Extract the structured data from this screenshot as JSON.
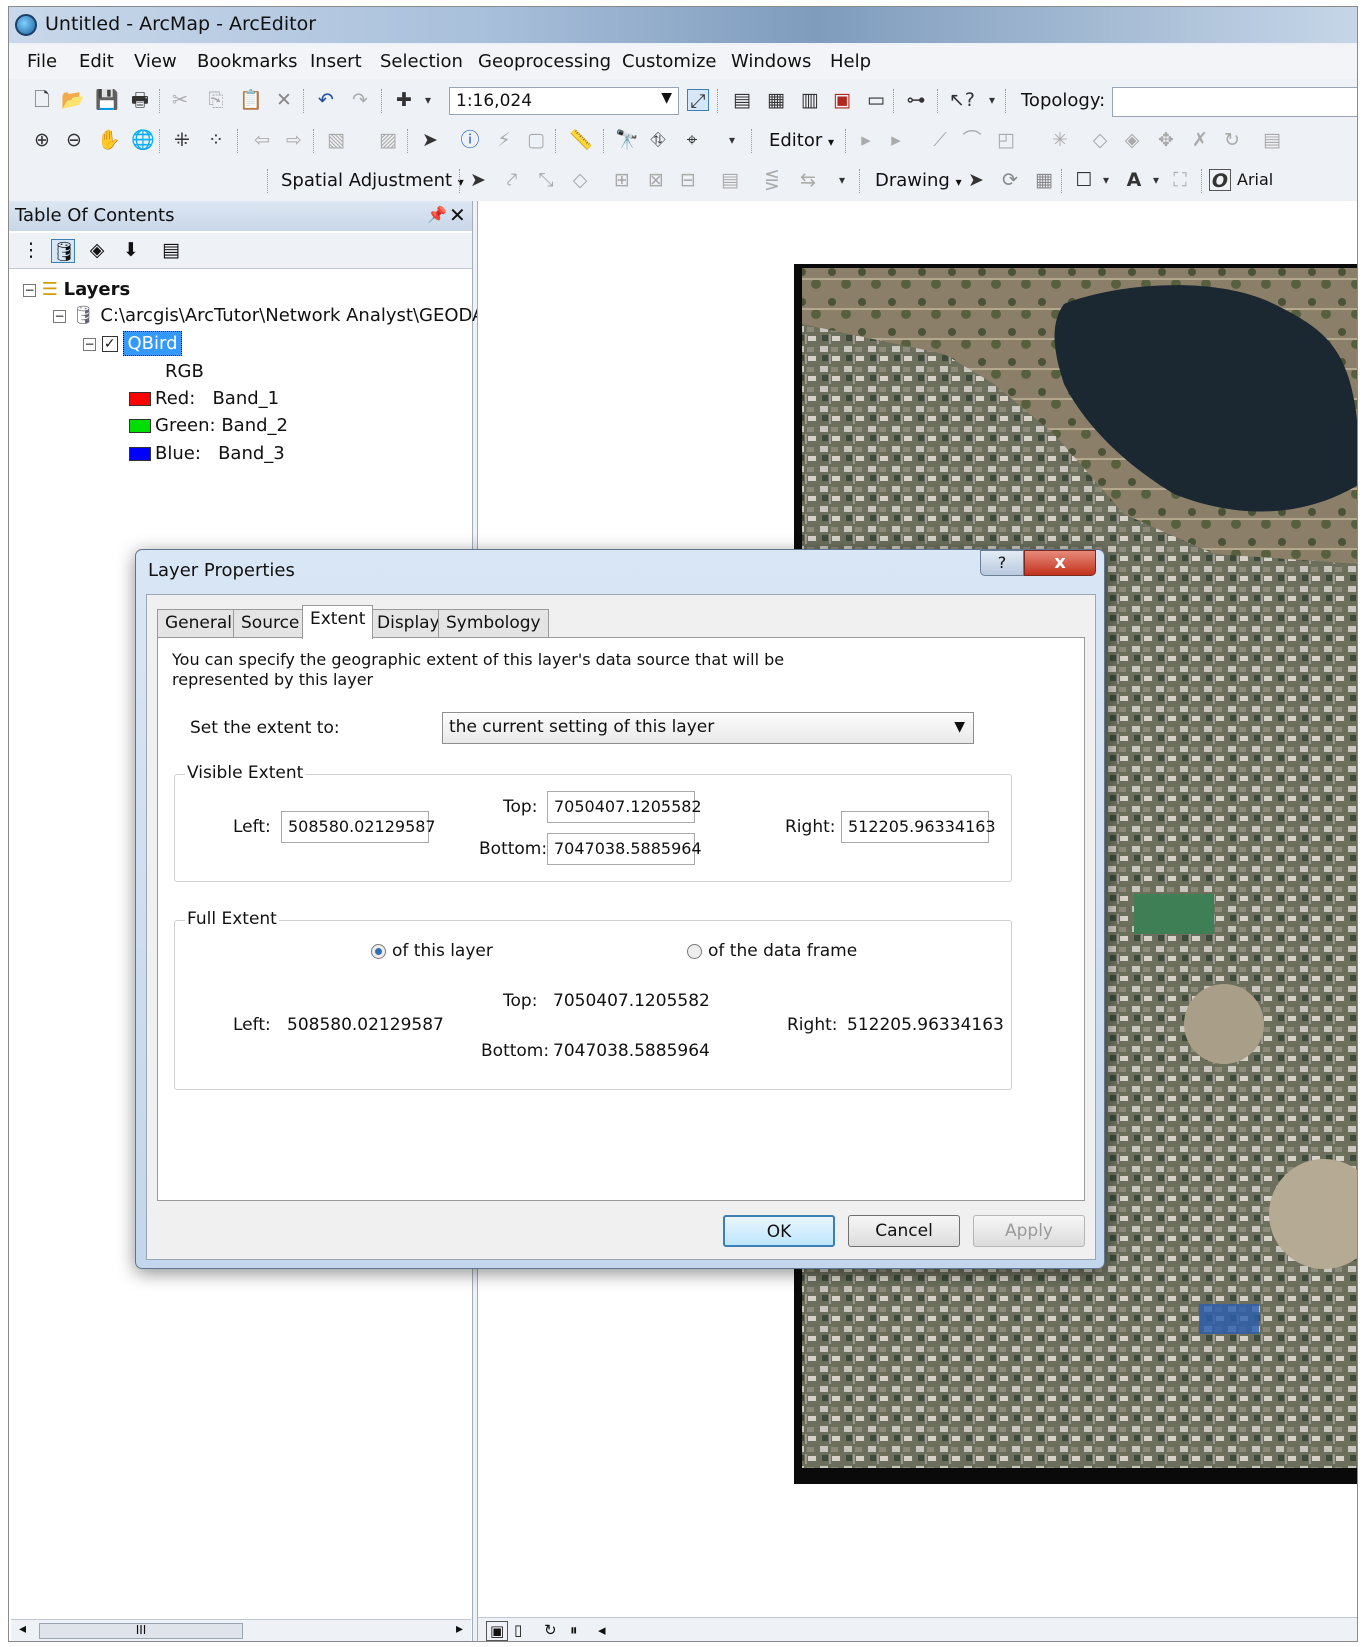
{
  "app": {
    "title": "Untitled - ArcMap - ArcEditor"
  },
  "menu": [
    "File",
    "Edit",
    "View",
    "Bookmarks",
    "Insert",
    "Selection",
    "Geoprocessing",
    "Customize",
    "Windows",
    "Help"
  ],
  "toolbar": {
    "scale": "1:16,024",
    "topology_label": "Topology:",
    "editor_label": "Editor",
    "spatial_adjustment_label": "Spatial Adjustment",
    "drawing_label": "Drawing",
    "font_name": "Arial"
  },
  "toc": {
    "title": "Table Of Contents",
    "layers_label": "Layers",
    "path": "C:\\arcgis\\ArcTutor\\Network Analyst\\GEODA",
    "layer_name": "QBird",
    "rgb_label": "RGB",
    "bands": [
      {
        "channel": "Red:",
        "band": "Band_1",
        "color": "#ff0000"
      },
      {
        "channel": "Green:",
        "band": "Band_2",
        "color": "#00dd00"
      },
      {
        "channel": "Blue:",
        "band": "Band_3",
        "color": "#0000ff"
      }
    ],
    "scroll_thumb": "III"
  },
  "dialog": {
    "title": "Layer Properties",
    "help": "?",
    "close": "x",
    "tabs": [
      "General",
      "Source",
      "Extent",
      "Display",
      "Symbology"
    ],
    "active_tab": "Extent",
    "description": "You can specify the geographic extent of this layer's data source that will be represented by this layer",
    "set_extent_label": "Set the extent to:",
    "set_extent_value": "the current setting of this layer",
    "visible": {
      "title": "Visible Extent",
      "left_label": "Left:",
      "left": "508580.02129587",
      "top_label": "Top:",
      "top": "7050407.1205582",
      "bottom_label": "Bottom:",
      "bottom": "7047038.5885964",
      "right_label": "Right:",
      "right": "512205.96334163"
    },
    "full": {
      "title": "Full Extent",
      "option_layer": "of this layer",
      "option_frame": "of the data frame",
      "left_label": "Left:",
      "left": "508580.02129587",
      "top_label": "Top:",
      "top": "7050407.1205582",
      "bottom_label": "Bottom:",
      "bottom": "7047038.5885964",
      "right_label": "Right:",
      "right": "512205.96334163"
    },
    "buttons": {
      "ok": "OK",
      "cancel": "Cancel",
      "apply": "Apply"
    }
  }
}
